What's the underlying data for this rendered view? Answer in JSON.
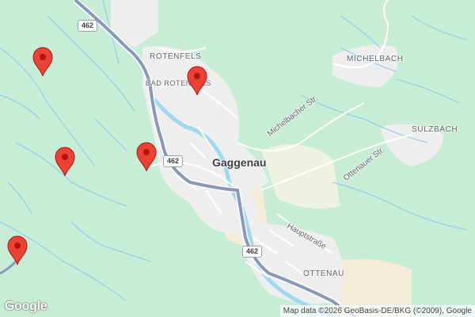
{
  "map": {
    "places": {
      "rotenfels": "ROTENFELS",
      "bad_rotenfels": "BAD ROTENFELS",
      "michelbach": "MICHELBACH",
      "sulzbach": "SULZBACH",
      "gaggenau": "Gaggenau",
      "ottenau": "OTTENAU"
    },
    "streets": {
      "michelbacher": "Michelbacher Str.",
      "ottenauer": "Ottenauer Str.",
      "haupt": "Hauptstraße"
    },
    "route_shields": [
      "462",
      "462",
      "462"
    ],
    "markers": [
      {
        "name": "marker-1",
        "color": "#ea4335"
      },
      {
        "name": "marker-2",
        "color": "#ea4335"
      },
      {
        "name": "marker-3",
        "color": "#ea4335"
      },
      {
        "name": "marker-4",
        "color": "#ea4335"
      },
      {
        "name": "marker-5",
        "color": "#ea4335"
      }
    ],
    "logo": "Google",
    "attribution": "Map data ©2026 GeoBasis-DE/BKG (©2009), Google"
  },
  "colors": {
    "forest": "#c8edd6",
    "urban": "#eeeeee",
    "water": "#9fd8f0",
    "highway": "#8898b8",
    "marker": "#ea4335"
  }
}
